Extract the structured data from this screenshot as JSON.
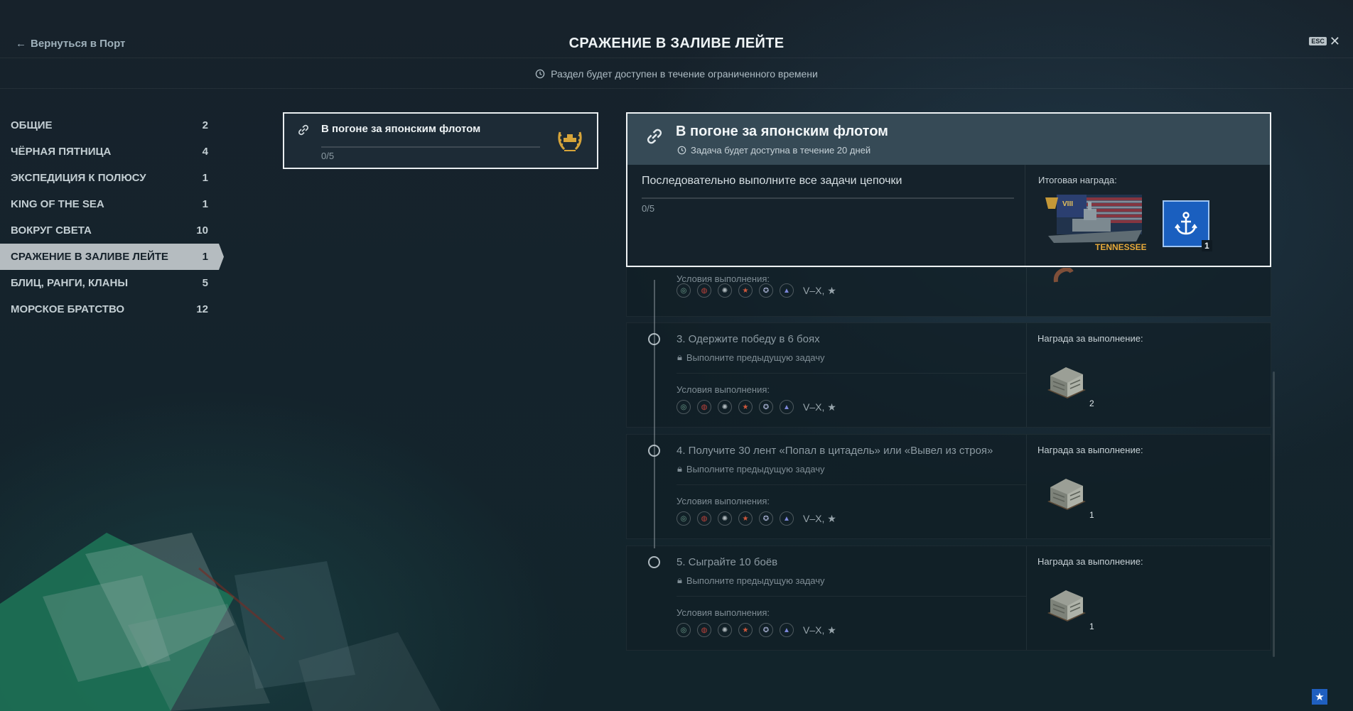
{
  "header": {
    "back_label": "Вернуться в Порт",
    "title": "СРАЖЕНИЕ В ЗАЛИВЕ ЛЕЙТЕ",
    "esc_label": "ESC",
    "close_glyph": "✕"
  },
  "notice": "Раздел будет доступен в течение ограниченного времени",
  "sidebar": {
    "items": [
      {
        "label": "ОБЩИЕ",
        "count": "2"
      },
      {
        "label": "ЧЁРНАЯ ПЯТНИЦА",
        "count": "4"
      },
      {
        "label": "ЭКСПЕДИЦИЯ К ПОЛЮСУ",
        "count": "1"
      },
      {
        "label": "KING OF THE SEA",
        "count": "1"
      },
      {
        "label": "ВОКРУГ СВЕТА",
        "count": "10"
      },
      {
        "label": "СРАЖЕНИЕ В ЗАЛИВЕ ЛЕЙТЕ",
        "count": "1"
      },
      {
        "label": "БЛИЦ, РАНГИ, КЛАНЫ",
        "count": "5"
      },
      {
        "label": "МОРСКОЕ БРАТСТВО",
        "count": "12"
      }
    ],
    "active_index": 5
  },
  "chain_card": {
    "title": "В погоне за японским флотом",
    "progress": "0/5",
    "progress_fraction": 0
  },
  "detail": {
    "title": "В погоне за японским флотом",
    "availability": "Задача будет доступна в течение 20 дней",
    "description": "Последовательно выполните все задачи цепочки",
    "progress": "0/5",
    "reward_label": "Итоговая награда:",
    "ship_name": "TENNESSEE",
    "ship_tier": "VIII",
    "flag_count": "1"
  },
  "tasks": [
    {
      "title": "",
      "lock_text": "",
      "conditions_label": "Условия выполнения:",
      "tier": "V–X, ★",
      "reward_label": "",
      "reward_count": ""
    },
    {
      "title": "3. Одержите победу в 6 боях",
      "lock_text": "Выполните предыдущую задачу",
      "conditions_label": "Условия выполнения:",
      "tier": "V–X, ★",
      "reward_label": "Награда за выполнение:",
      "reward_count": "2"
    },
    {
      "title": "4. Получите 30 лент «Попал в цитадель» или «Вывел из строя»",
      "lock_text": "Выполните предыдущую задачу",
      "conditions_label": "Условия выполнения:",
      "tier": "V–X, ★",
      "reward_label": "Награда за выполнение:",
      "reward_count": "1"
    },
    {
      "title": "5. Сыграйте 10 боёв",
      "lock_text": "Выполните предыдущую задачу",
      "conditions_label": "Условия выполнения:",
      "tier": "V–X, ★",
      "reward_label": "Награда за выполнение:",
      "reward_count": "1"
    }
  ],
  "nations": [
    "nation-1-icon",
    "nation-2-icon",
    "nation-3-icon",
    "nation-4-icon",
    "nation-5-icon",
    "nation-6-icon"
  ],
  "colors": {
    "accent_blue": "#1a5fbf",
    "gold": "#d7a53a",
    "active_tab": "#b5bcc0"
  }
}
